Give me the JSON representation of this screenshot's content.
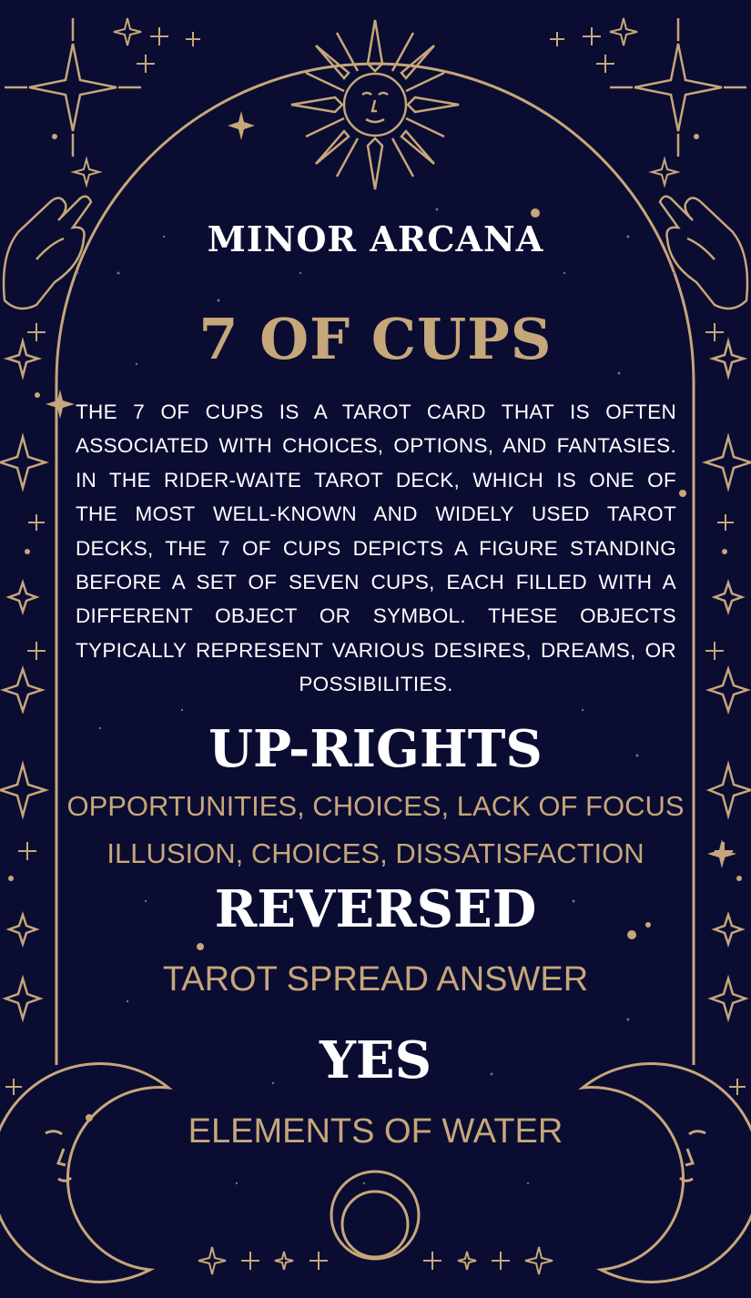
{
  "card": {
    "subtitle": "MINOR ARCANA",
    "title": "7 OF CUPS",
    "description": "THE 7 OF CUPS IS A TAROT CARD THAT IS OFTEN ASSOCIATED WITH CHOICES, OPTIONS, AND FANTASIES. IN THE RIDER-WAITE TAROT DECK, WHICH IS ONE OF THE MOST WELL-KNOWN AND WIDELY USED TAROT DECKS, THE 7 OF CUPS DEPICTS A FIGURE STANDING BEFORE A SET OF SEVEN CUPS, EACH FILLED WITH A DIFFERENT OBJECT OR SYMBOL. THESE OBJECTS TYPICALLY REPRESENT VARIOUS DESIRES, DREAMS, OR POSSIBILITIES.",
    "upright_heading": "UP-RIGHTS",
    "upright_meaning": "OPPORTUNITIES, CHOICES, LACK OF FOCUS",
    "reversed_meaning": "ILLUSION, CHOICES, DISSATISFACTION",
    "reversed_heading": "REVERSED",
    "spread_label": "TAROT SPREAD ANSWER",
    "answer": "YES",
    "element": "ELEMENTS OF WATER"
  },
  "colors": {
    "background": "#0b0c32",
    "gold": "#c6a77a",
    "text": "#ffffff"
  },
  "icons": [
    "sun-face-icon",
    "crescent-moon-face-icon",
    "praying-hand-icon",
    "sparkle-star-icon",
    "ring-icon"
  ]
}
